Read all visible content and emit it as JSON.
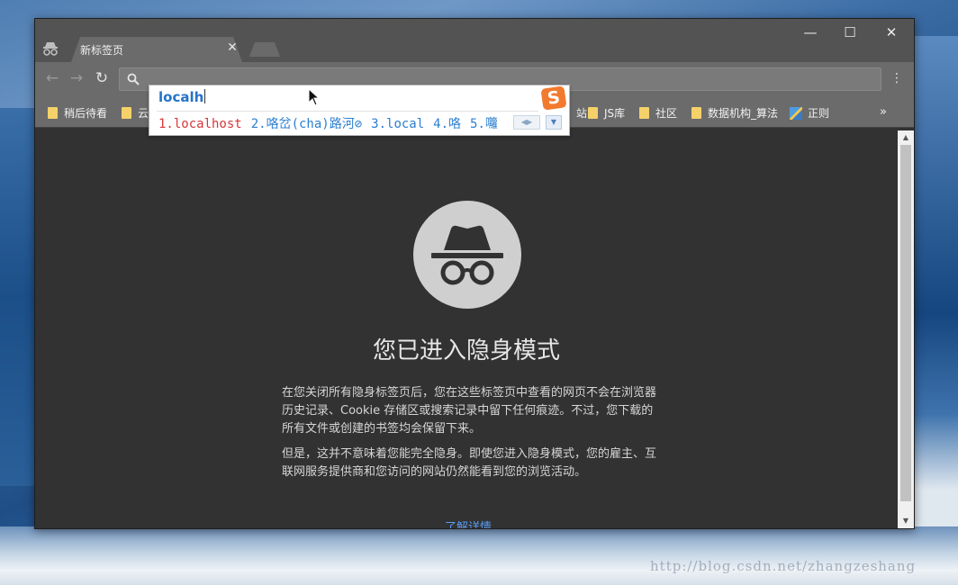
{
  "tab": {
    "title": "新标签页",
    "close": "✕"
  },
  "window_controls": {
    "minimize": "—",
    "maximize": "☐",
    "close": "✕"
  },
  "nav": {
    "back": "←",
    "forward": "→",
    "reload": "↻",
    "menu": "⋮"
  },
  "omnibox": {
    "value": "",
    "icon": "search-icon"
  },
  "bookmarks": [
    {
      "label": "稍后待看",
      "icon": "folder"
    },
    {
      "label": "云",
      "icon": "folder"
    },
    {
      "label": "站",
      "icon": "folder"
    },
    {
      "label": "JS库",
      "icon": "folder"
    },
    {
      "label": "社区",
      "icon": "folder"
    },
    {
      "label": "数据机构_算法",
      "icon": "folder"
    },
    {
      "label": "正则",
      "icon": "page"
    }
  ],
  "bookmarks_more": "»",
  "ime": {
    "composition": "localh",
    "candidates": [
      "1.localhost",
      "2.咯岔(cha)路河⊘",
      "3.local",
      "4.咯",
      "5.囖"
    ],
    "logo": "S",
    "paging": "◀▶",
    "expand": "▼"
  },
  "page": {
    "heading": "您已进入隐身模式",
    "paragraph1": "在您关闭所有隐身标签页后，您在这些标签页中查看的网页不会在浏览器历史记录、Cookie 存储区或搜索记录中留下任何痕迹。不过，您下载的所有文件或创建的书签均会保留下来。",
    "paragraph2": "但是，这并不意味着您能完全隐身。即使您进入隐身模式，您的雇主、互联网服务提供商和您访问的网站仍然能看到您的浏览活动。",
    "learn_more": "了解详情"
  },
  "scrollbar": {
    "up": "▲",
    "down": "▼"
  },
  "watermark": "http://blog.csdn.net/zhangzeshang"
}
